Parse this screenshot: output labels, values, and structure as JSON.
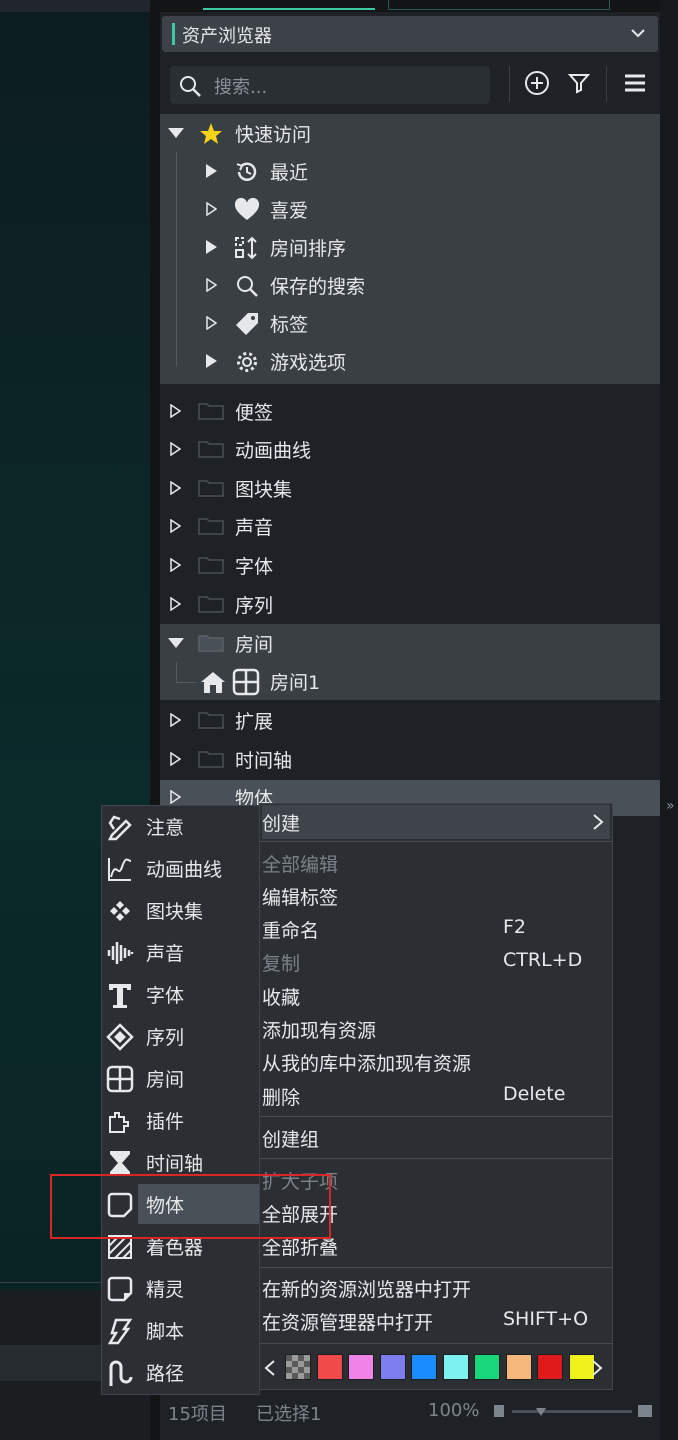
{
  "panel": {
    "title": "资产浏览器",
    "search_placeholder": "搜索...",
    "quick_access": {
      "label": "快速访问",
      "items": [
        {
          "label": "最近",
          "icon": "history-icon"
        },
        {
          "label": "喜爱",
          "icon": "heart-icon"
        },
        {
          "label": "房间排序",
          "icon": "room-order-icon"
        },
        {
          "label": "保存的搜索",
          "icon": "search-icon"
        },
        {
          "label": "标签",
          "icon": "tag-icon"
        },
        {
          "label": "游戏选项",
          "icon": "gear-icon"
        }
      ]
    },
    "groups": [
      "便签",
      "动画曲线",
      "图块集",
      "声音",
      "字体",
      "序列"
    ],
    "room_group": {
      "label": "房间",
      "child": "房间1"
    },
    "groups2": [
      "扩展",
      "时间轴"
    ],
    "selected_group": "物体",
    "status": {
      "count": "15项目",
      "selected": "已选择1",
      "zoom": "100%"
    }
  },
  "context_menu": {
    "create": "创建",
    "edit_all": "全部编辑",
    "edit_tags": "编辑标签",
    "rename": "重命名",
    "rename_key": "F2",
    "copy": "复制",
    "copy_key": "CTRL+D",
    "favorite": "收藏",
    "add_existing": "添加现有资源",
    "add_from_library": "从我的库中添加现有资源",
    "delete": "删除",
    "delete_key": "Delete",
    "create_group": "创建组",
    "expand_children": "扩大子项",
    "expand_all": "全部展开",
    "collapse_all": "全部折叠",
    "open_new_browser": "在新的资源浏览器中打开",
    "open_explorer": "在资源管理器中打开",
    "open_explorer_key": "SHIFT+O",
    "colors": [
      "#888888",
      "#f04a4a",
      "#f083e6",
      "#7d7df0",
      "#1a8cff",
      "#7df0f0",
      "#1ad67a",
      "#f5b87a",
      "#e01a1a",
      "#f0f01a"
    ]
  },
  "create_submenu": {
    "items": [
      {
        "label": "注意",
        "icon": "note-icon"
      },
      {
        "label": "动画曲线",
        "icon": "anim-curve-icon"
      },
      {
        "label": "图块集",
        "icon": "tileset-icon"
      },
      {
        "label": "声音",
        "icon": "sound-icon"
      },
      {
        "label": "字体",
        "icon": "font-icon"
      },
      {
        "label": "序列",
        "icon": "sequence-icon"
      },
      {
        "label": "房间",
        "icon": "room-icon"
      },
      {
        "label": "插件",
        "icon": "extension-icon"
      },
      {
        "label": "时间轴",
        "icon": "timeline-icon"
      },
      {
        "label": "物体",
        "icon": "object-icon"
      },
      {
        "label": "着色器",
        "icon": "shader-icon"
      },
      {
        "label": "精灵",
        "icon": "sprite-icon"
      },
      {
        "label": "脚本",
        "icon": "script-icon"
      },
      {
        "label": "路径",
        "icon": "path-icon"
      }
    ]
  }
}
